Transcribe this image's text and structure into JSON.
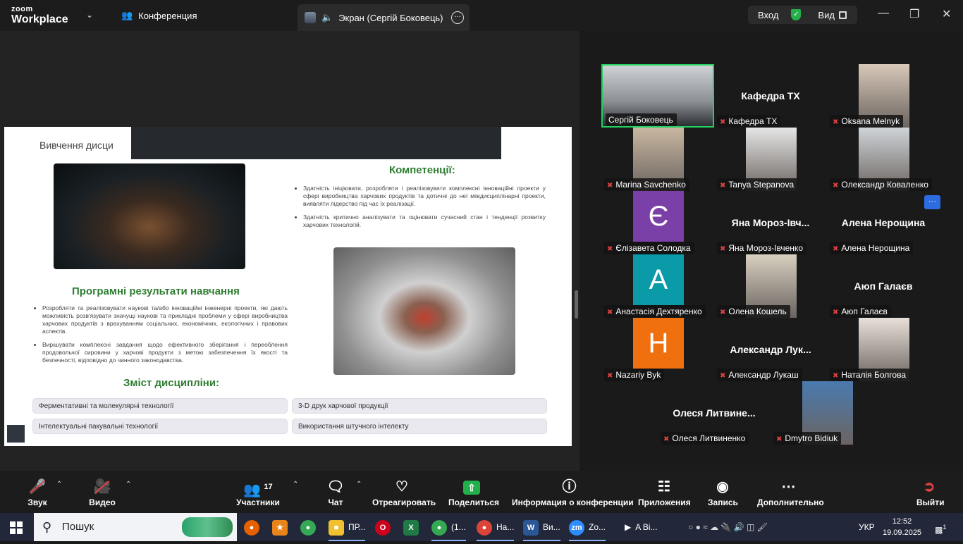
{
  "titlebar": {
    "logo_top": "zoom",
    "logo_bottom": "Workplace",
    "conference_tab": "Конференция",
    "screen_tab": "Экран (Сергій Боковець)",
    "signin": "Вход",
    "view": "Вид"
  },
  "slide": {
    "title": "Вивчення дисци",
    "competencies_heading": "Компетенції:",
    "competencies": [
      "Здатність ініціювати, розробляти і реалізовувати комплексні інноваційні проекти у сфері виробництва харчових продуктів та дотичні до неї міждисциплінарні проекти, виявляти лідерство під час їх реалізації.",
      "Здатність критично аналізувати та оцінювати сучасний стан і тенденції розвитку харчових технологій."
    ],
    "outcomes_heading": "Програмні результати навчання",
    "outcomes": [
      "Розробляти та реалізовувати наукові та/або інноваційні інженерні проекти, які дають можливість розв'язувати значущі наукові та прикладні проблеми у сфері виробництва харчових продуктів з врахуванням соціальних, економічних, екологічних і правових аспектів.",
      "Вирішувати комплексні завдання щодо ефективного зберігання і переоблення продовольчої сировини у харчові продукти з метою забезпечення їх якості та безпечності, відповідно до чинного законодавства."
    ],
    "content_heading": "Зміст дисципліни:",
    "chips": [
      "Ферментативні та молекулярні технології",
      "3-D друк харчової продукції",
      "Інтелектуальні пакувальні технології",
      "Використання штучного інтелекту"
    ]
  },
  "participants": {
    "active": "Сергій Боковець",
    "tiles": [
      {
        "big": "Кафедра ТХ",
        "label": "Кафедра ТХ"
      },
      {
        "label": "Oksana Melnyk"
      },
      {
        "label": "Marina Savchenko"
      },
      {
        "label": "Tanya Stepanova"
      },
      {
        "label": "Олександр Коваленко"
      },
      {
        "letter": "Є",
        "label": "Єлізавета Солодка"
      },
      {
        "big": "Яна  Мороз-Івч...",
        "label": "Яна Мороз-Івченко"
      },
      {
        "big": "Алена Нерощина",
        "label": "Алена Нерощина"
      },
      {
        "letter": "A",
        "label": "Анастасія Дехтяренко"
      },
      {
        "label": "Олена Кошель"
      },
      {
        "big": "Аюп Галаєв",
        "label": "Аюп Галаєв"
      },
      {
        "letter": "H",
        "label": "Nazariy Byk"
      },
      {
        "big": "Александр  Лук...",
        "label": "Александр Лукаш"
      },
      {
        "label": "Наталія Болгова"
      },
      {
        "big": "Олеся  Литвине...",
        "label": "Олеся Литвиненко"
      },
      {
        "label": "Dmytro Bidiuk"
      }
    ],
    "more_button": "···"
  },
  "toolbar": {
    "audio": "Звук",
    "video": "Видео",
    "participants": "Участники",
    "participants_count": "17",
    "chat": "Чат",
    "react": "Отреагировать",
    "share": "Поделиться",
    "info": "Информация о конференции",
    "apps": "Приложения",
    "record": "Запись",
    "more": "Дополнительно",
    "leave": "Выйти"
  },
  "taskbar": {
    "search": "Пошук",
    "items": [
      "ПР...",
      "(1...",
      "На...",
      "Ви...",
      "Zo...",
      "A Ві..."
    ],
    "lang": "УКР",
    "time": "12:52",
    "date": "19.09.2025",
    "notif": "1"
  },
  "colors": {
    "accent_green": "#23b04a",
    "slide_green": "#2e7d32",
    "active_border": "#23d160",
    "mute_red": "#e04040"
  }
}
